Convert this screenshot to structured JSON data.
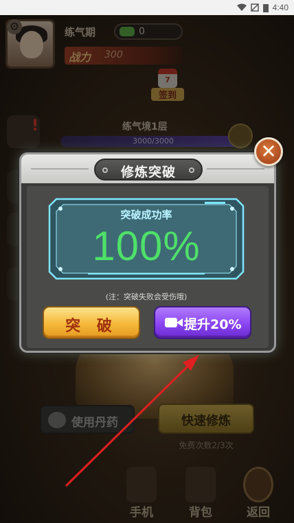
{
  "status_bar": {
    "time": "4:40"
  },
  "player": {
    "rank": "练气期",
    "spirit_stones": "0",
    "power_label": "战力",
    "power_value": "300"
  },
  "checkin": {
    "day": "7",
    "label": "签到"
  },
  "realm": {
    "name": "练气境1层",
    "exp": "3000/3000"
  },
  "actions": {
    "use_pill": "使用丹药",
    "fast_cultivate": "快速修炼",
    "free_count": "免费次数2/3次"
  },
  "dock": [
    {
      "label": "手机",
      "icon": "phone-icon"
    },
    {
      "label": "背包",
      "icon": "backpack-icon"
    },
    {
      "label": "返回",
      "icon": "return-arrow-icon"
    }
  ],
  "dialog": {
    "title": "修炼突破",
    "rate_label": "突破成功率",
    "rate_value": "100%",
    "note": "(注：突破失败会受伤哦)",
    "break_button": "突 破",
    "boost_button": "提升20%"
  },
  "colors": {
    "rate_green": "#4fe06a",
    "break_button": "#f4b839",
    "boost_button": "#8a45f2",
    "close_button": "#c9582a",
    "arrow": "#e02020"
  }
}
